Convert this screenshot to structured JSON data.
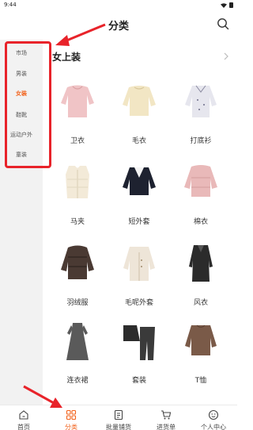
{
  "status_bar": {
    "time": "9:44"
  },
  "header": {
    "title": "分类"
  },
  "sidebar": {
    "items": [
      {
        "label": "市场",
        "active": false
      },
      {
        "label": "男装",
        "active": false
      },
      {
        "label": "女装",
        "active": true
      },
      {
        "label": "鞋靴",
        "active": false
      },
      {
        "label": "运动户外",
        "active": false
      },
      {
        "label": "童装",
        "active": false
      }
    ]
  },
  "content": {
    "section_title": "女上装",
    "items": [
      {
        "label": "卫衣",
        "icon": "hoodie-image"
      },
      {
        "label": "毛衣",
        "icon": "sweater-image"
      },
      {
        "label": "打底衫",
        "icon": "base-shirt-image"
      },
      {
        "label": "马夹",
        "icon": "vest-image"
      },
      {
        "label": "短外套",
        "icon": "short-jacket-image"
      },
      {
        "label": "棉衣",
        "icon": "padded-coat-image"
      },
      {
        "label": "羽绒服",
        "icon": "down-jacket-image"
      },
      {
        "label": "毛呢外套",
        "icon": "wool-coat-image"
      },
      {
        "label": "风衣",
        "icon": "trench-coat-image"
      },
      {
        "label": "连衣裙",
        "icon": "dress-image"
      },
      {
        "label": "套装",
        "icon": "suit-set-image"
      },
      {
        "label": "T恤",
        "icon": "tshirt-image"
      }
    ]
  },
  "tabbar": {
    "items": [
      {
        "label": "首页",
        "icon": "home-icon",
        "active": false
      },
      {
        "label": "分类",
        "icon": "category-icon",
        "active": true
      },
      {
        "label": "批量铺货",
        "icon": "batch-icon",
        "active": false
      },
      {
        "label": "进货单",
        "icon": "cart-icon",
        "active": false
      },
      {
        "label": "个人中心",
        "icon": "profile-icon",
        "active": false
      }
    ]
  },
  "colors": {
    "accent": "#f2621b",
    "annotation": "#e8232a",
    "sidebar_bg": "#f2f2f2"
  }
}
